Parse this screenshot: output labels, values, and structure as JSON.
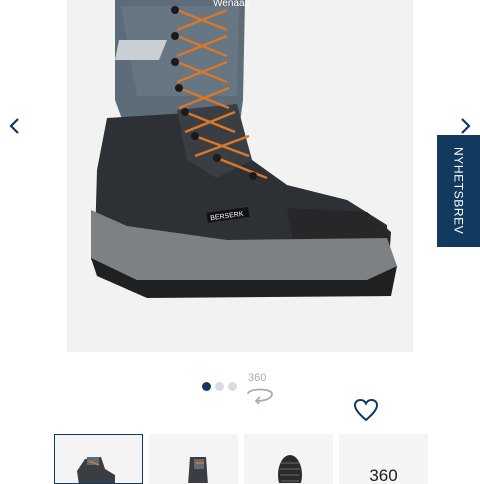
{
  "product_image": {
    "brand_tag": "Wenaas",
    "logo_label": "BERSERK"
  },
  "newsletter": {
    "label": "NYHETSBREV"
  },
  "gallery": {
    "view360_label": "360",
    "slide_count": 3,
    "active_index": 0
  },
  "thumbnails": [
    {
      "kind": "boot-side"
    },
    {
      "kind": "boot-back"
    },
    {
      "kind": "sole"
    },
    {
      "kind": "360",
      "label": "360"
    }
  ],
  "icons": {
    "prev": "chevron-left-icon",
    "next": "chevron-right-icon",
    "wishlist": "heart-icon",
    "rotate": "rotate-360-icon"
  },
  "colors": {
    "accent": "#123a5f",
    "lace": "#d9772b",
    "textile": "#5d6c78"
  }
}
